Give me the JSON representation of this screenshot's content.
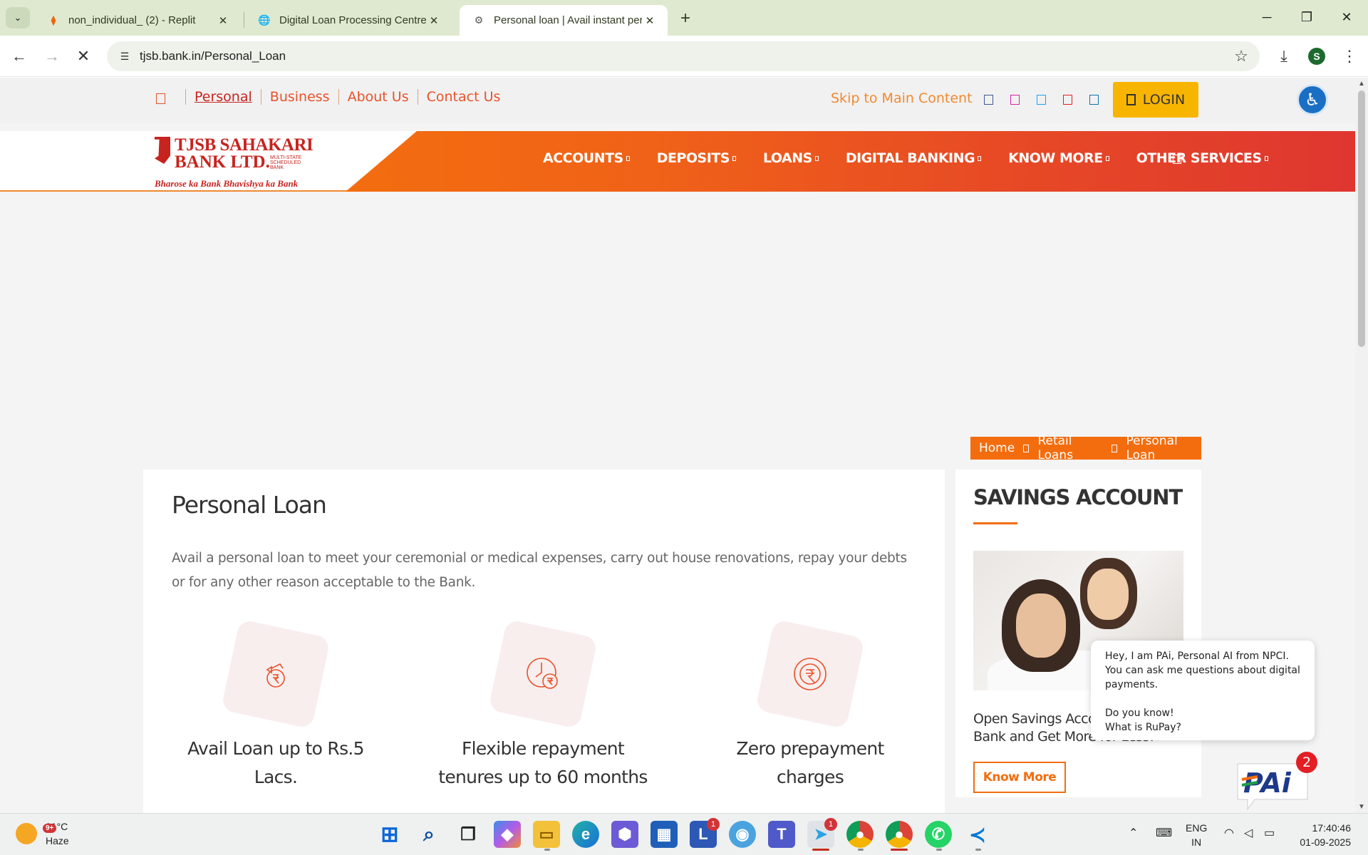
{
  "browser": {
    "tabs": [
      {
        "title": "non_individual_ (2) - Replit",
        "icon": "replit-icon",
        "active": false
      },
      {
        "title": "Digital Loan Processing Centre",
        "icon": "globe-icon",
        "active": false
      },
      {
        "title": "Personal loan | Avail instant per",
        "icon": "tjsb-favicon-icon",
        "active": true
      }
    ],
    "url": "tjsb.bank.in/Personal_Loan",
    "profile_initial": "S"
  },
  "topbar": {
    "links": [
      "Personal",
      "Business",
      "About Us",
      "Contact Us"
    ],
    "skip_link": "Skip to Main Content",
    "login_label": "LOGIN",
    "social_icons": [
      "facebook-icon",
      "instagram-icon",
      "twitter-icon",
      "youtube-icon",
      "linkedin-icon"
    ]
  },
  "logo": {
    "name_line1": "TJSB SAHAKARI",
    "name_line2": "BANK LTD.",
    "sub": "MULTI-STATE SCHEDULED BANK",
    "tagline": "Bharose ka Bank Bhavishya ka Bank"
  },
  "nav": {
    "items": [
      "ACCOUNTS",
      "DEPOSITS",
      "LOANS",
      "DIGITAL BANKING",
      "KNOW MORE",
      "OTHER SERVICES"
    ]
  },
  "breadcrumb": {
    "items": [
      "Home",
      "Retail Loans",
      "Personal Loan"
    ]
  },
  "main": {
    "title": "Personal Loan",
    "intro": "Avail a personal loan to meet your ceremonial or medical expenses, carry out house renovations, repay your debts or for any other reason acceptable to the Bank.",
    "features": [
      {
        "label": "Avail Loan up to Rs.5 Lacs.",
        "icon": "money-bag-rupee-icon"
      },
      {
        "label": "Flexible repayment tenures up to 60 months",
        "icon": "clock-rupee-icon"
      },
      {
        "label": "Zero prepayment charges",
        "icon": "rupee-circle-icon"
      }
    ]
  },
  "sidebar": {
    "title": "SAVINGS ACCOUNT",
    "description": "Open Savings Account with TJSB Bank and Get More for Less!",
    "cta": "Know More"
  },
  "pai": {
    "line1": "Hey, I am PAi, Personal AI from NPCI.",
    "line2": "You can ask me questions about digital payments.",
    "line3": "Do you know!",
    "line4": "What is RuPay?",
    "badge": "2",
    "logo_text": "PAi"
  },
  "taskbar": {
    "weather_temp": "31°C",
    "weather_desc": "Haze",
    "weather_badge": "9+",
    "lang1": "ENG",
    "lang2": "IN",
    "time": "17:40:46",
    "date": "01-09-2025",
    "badge_l": "1",
    "badge_telegram": "1"
  },
  "colors": {
    "accent": "#f36d0f",
    "brand_red": "#c8231f",
    "login_yellow": "#f8b500"
  }
}
